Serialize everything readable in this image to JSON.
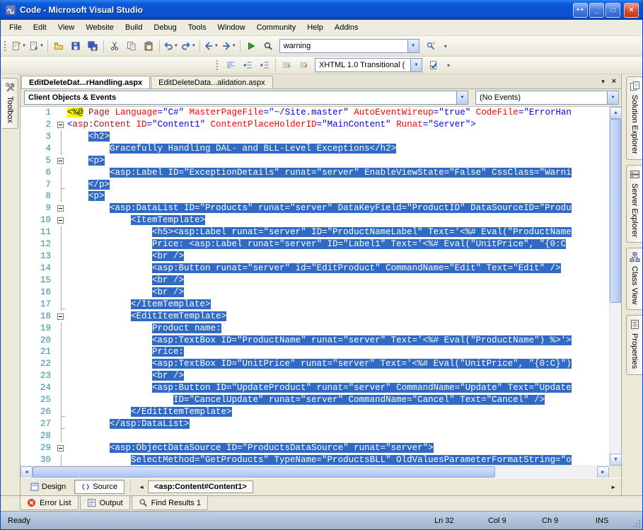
{
  "window": {
    "title": "Code - Microsoft Visual Studio"
  },
  "icons": {
    "dropdown_arrow": "▼",
    "up_arrow": "▲",
    "arrow_left": "◄",
    "arrow_right": "►",
    "close": "×",
    "minimize": "_",
    "restore": "□",
    "window_nav": "◄►",
    "overflow": "▾"
  },
  "menu": {
    "items": [
      "File",
      "Edit",
      "View",
      "Website",
      "Build",
      "Debug",
      "Tools",
      "Window",
      "Community",
      "Help",
      "Addins"
    ]
  },
  "toolbars": {
    "find_combo_value": "warning",
    "schema_combo_value": "XHTML 1.0 Transitional ("
  },
  "document_tabs": [
    {
      "label": "EditDeleteDat...rHandling.aspx",
      "active": true
    },
    {
      "label": "EditDeleteData...alidation.aspx",
      "active": false
    }
  ],
  "navigation_bar": {
    "left_dropdown": "Client Objects & Events",
    "right_dropdown": "(No Events)"
  },
  "editor": {
    "selection_color": "#316AC5",
    "lines": [
      {
        "n": 1,
        "sel": false,
        "tokens": [
          [
            "d",
            "<%@"
          ],
          [
            "p",
            " "
          ],
          [
            "k",
            "Page"
          ],
          [
            "p",
            " "
          ],
          [
            "a",
            "Language"
          ],
          [
            "o",
            "="
          ],
          [
            "v",
            "\"C#\""
          ],
          [
            "p",
            " "
          ],
          [
            "a",
            "MasterPageFile"
          ],
          [
            "o",
            "="
          ],
          [
            "v",
            "\"~/Site.master\""
          ],
          [
            "p",
            " "
          ],
          [
            "a",
            "AutoEventWireup"
          ],
          [
            "o",
            "="
          ],
          [
            "v",
            "\"true\""
          ],
          [
            "p",
            " "
          ],
          [
            "a",
            "CodeFile"
          ],
          [
            "o",
            "="
          ],
          [
            "v",
            "\"ErrorHan"
          ]
        ]
      },
      {
        "n": 2,
        "sel": false,
        "fold": "box",
        "tokens": [
          [
            "o",
            "<"
          ],
          [
            "k",
            "asp:Content"
          ],
          [
            "p",
            " "
          ],
          [
            "a",
            "ID"
          ],
          [
            "o",
            "="
          ],
          [
            "v",
            "\"Content1\""
          ],
          [
            "p",
            " "
          ],
          [
            "a",
            "ContentPlaceHolderID"
          ],
          [
            "o",
            "="
          ],
          [
            "v",
            "\"MainContent\""
          ],
          [
            "p",
            " "
          ],
          [
            "a",
            "Runat"
          ],
          [
            "o",
            "="
          ],
          [
            "v",
            "\"Server\""
          ],
          [
            "o",
            ">"
          ]
        ]
      },
      {
        "n": 3,
        "sel": true,
        "indent": 4,
        "text": "<h2>"
      },
      {
        "n": 4,
        "sel": true,
        "indent": 8,
        "text": "Gracefully Handling DAL- and BLL-Level Exceptions</h2>"
      },
      {
        "n": 5,
        "sel": true,
        "fold": "box",
        "indent": 4,
        "text": "<p>"
      },
      {
        "n": 6,
        "sel": true,
        "indent": 8,
        "text": "<asp:Label ID=\"ExceptionDetails\" runat=\"server\" EnableViewState=\"False\" CssClass=\"Warni"
      },
      {
        "n": 7,
        "sel": true,
        "fold": "end",
        "indent": 4,
        "text": "</p>"
      },
      {
        "n": 8,
        "sel": true,
        "indent": 4,
        "text": "<p>"
      },
      {
        "n": 9,
        "sel": true,
        "fold": "box",
        "indent": 8,
        "text": "<asp:DataList ID=\"Products\" runat=\"server\" DataKeyField=\"ProductID\" DataSourceID=\"Produ"
      },
      {
        "n": 10,
        "sel": true,
        "fold": "box",
        "indent": 12,
        "text": "<ItemTemplate>"
      },
      {
        "n": 11,
        "sel": true,
        "indent": 16,
        "text": "<h5><asp:Label runat=\"server\" ID=\"ProductNameLabel\" Text='<%# Eval(\"ProductName"
      },
      {
        "n": 12,
        "sel": true,
        "indent": 16,
        "text": "Price: <asp:Label runat=\"server\" ID=\"Label1\" Text='<%# Eval(\"UnitPrice\", \"{0:C"
      },
      {
        "n": 13,
        "sel": true,
        "indent": 16,
        "text": "<br />"
      },
      {
        "n": 14,
        "sel": true,
        "indent": 16,
        "text": "<asp:Button runat=\"server\" id=\"EditProduct\" CommandName=\"Edit\" Text=\"Edit\" />"
      },
      {
        "n": 15,
        "sel": true,
        "indent": 16,
        "text": "<br />"
      },
      {
        "n": 16,
        "sel": true,
        "indent": 16,
        "text": "<br />"
      },
      {
        "n": 17,
        "sel": true,
        "fold": "end",
        "indent": 12,
        "text": "</ItemTemplate>"
      },
      {
        "n": 18,
        "sel": true,
        "fold": "box",
        "indent": 12,
        "text": "<EditItemTemplate>"
      },
      {
        "n": 19,
        "sel": true,
        "indent": 16,
        "text": "Product name:"
      },
      {
        "n": 20,
        "sel": true,
        "indent": 16,
        "text": "<asp:TextBox ID=\"ProductName\" runat=\"server\" Text='<%# Eval(\"ProductName\") %>'>"
      },
      {
        "n": 21,
        "sel": true,
        "indent": 16,
        "text": "Price:"
      },
      {
        "n": 22,
        "sel": true,
        "indent": 16,
        "text": "<asp:TextBox ID=\"UnitPrice\" runat=\"server\" Text='<%# Eval(\"UnitPrice\", \"{0:C}\")"
      },
      {
        "n": 23,
        "sel": true,
        "indent": 16,
        "text": "<br />"
      },
      {
        "n": 24,
        "sel": true,
        "indent": 16,
        "text": "<asp:Button ID=\"UpdateProduct\" runat=\"server\" CommandName=\"Update\" Text=\"Update"
      },
      {
        "n": 25,
        "sel": true,
        "indent": 20,
        "text": "ID=\"CancelUpdate\" runat=\"server\" CommandName=\"Cancel\" Text=\"Cancel\" />"
      },
      {
        "n": 26,
        "sel": true,
        "fold": "end",
        "indent": 12,
        "text": "</EditItemTemplate>"
      },
      {
        "n": 27,
        "sel": true,
        "fold": "end",
        "indent": 8,
        "text": "</asp:DataList>"
      },
      {
        "n": 28,
        "sel": false,
        "indent": 0,
        "text": ""
      },
      {
        "n": 29,
        "sel": true,
        "fold": "box",
        "indent": 8,
        "text": "<asp:ObjectDataSource ID=\"ProductsDataSource\" runat=\"server\">"
      },
      {
        "n": 30,
        "sel": true,
        "indent": 12,
        "text": "SelectMethod=\"GetProducts\" TypeName=\"ProductsBLL\" OldValuesParameterFormatString=\"o"
      }
    ]
  },
  "view_switcher": {
    "design_label": "Design",
    "source_label": "Source",
    "tag_path": "<asp:Content#Content1>"
  },
  "dock_tabs": {
    "left": [
      {
        "label": "Toolbox",
        "icon": "toolbox-icon"
      }
    ],
    "right": [
      {
        "label": "Solution Explorer",
        "icon": "solution-explorer-icon"
      },
      {
        "label": "Server Explorer",
        "icon": "server-explorer-icon"
      },
      {
        "label": "Class View",
        "icon": "class-view-icon"
      },
      {
        "label": "Properties",
        "icon": "properties-icon"
      }
    ]
  },
  "bottom_panels": [
    {
      "label": "Error List",
      "icon": "error-list-icon"
    },
    {
      "label": "Output",
      "icon": "output-icon"
    },
    {
      "label": "Find Results 1",
      "icon": "find-results-icon"
    }
  ],
  "status_bar": {
    "message": "Ready",
    "line": "Ln 32",
    "column": "Col 9",
    "character": "Ch 9",
    "mode": "INS"
  }
}
